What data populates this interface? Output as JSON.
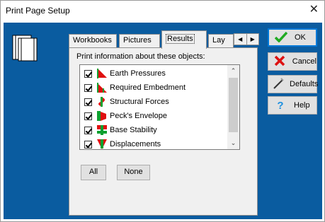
{
  "window": {
    "title": "Print Page Setup",
    "close_glyph": "✕"
  },
  "tabs": [
    {
      "label": "Workbooks"
    },
    {
      "label": "Pictures"
    },
    {
      "label": "Results",
      "active": true
    },
    {
      "label": "Lay"
    }
  ],
  "tab_arrows": {
    "left": "◀",
    "right": "▶"
  },
  "panel": {
    "label": "Print information about these objects:"
  },
  "items": [
    {
      "label": "Earth Pressures",
      "checked": true,
      "icon": "earth-pressures-icon"
    },
    {
      "label": "Required Embedment",
      "checked": true,
      "icon": "required-embedment-icon"
    },
    {
      "label": "Structural Forces",
      "checked": true,
      "icon": "structural-forces-icon"
    },
    {
      "label": "Peck's Envelope",
      "checked": true,
      "icon": "pecks-envelope-icon"
    },
    {
      "label": "Base Stability",
      "checked": true,
      "icon": "base-stability-icon"
    },
    {
      "label": "Displacements",
      "checked": true,
      "icon": "displacements-icon"
    }
  ],
  "scroll": {
    "up": "⌃",
    "down": "⌄"
  },
  "buttons": {
    "all": "All",
    "none": "None",
    "ok": "OK",
    "cancel": "Cancel",
    "defaults": "Defaults",
    "help": "Help"
  },
  "colors": {
    "client_bg": "#0a5ca0",
    "icon_red": "#e01010",
    "icon_green": "#10a030",
    "ok_green": "#22aa22",
    "cancel_red": "#dd1111",
    "help_blue": "#1a8fe0"
  }
}
